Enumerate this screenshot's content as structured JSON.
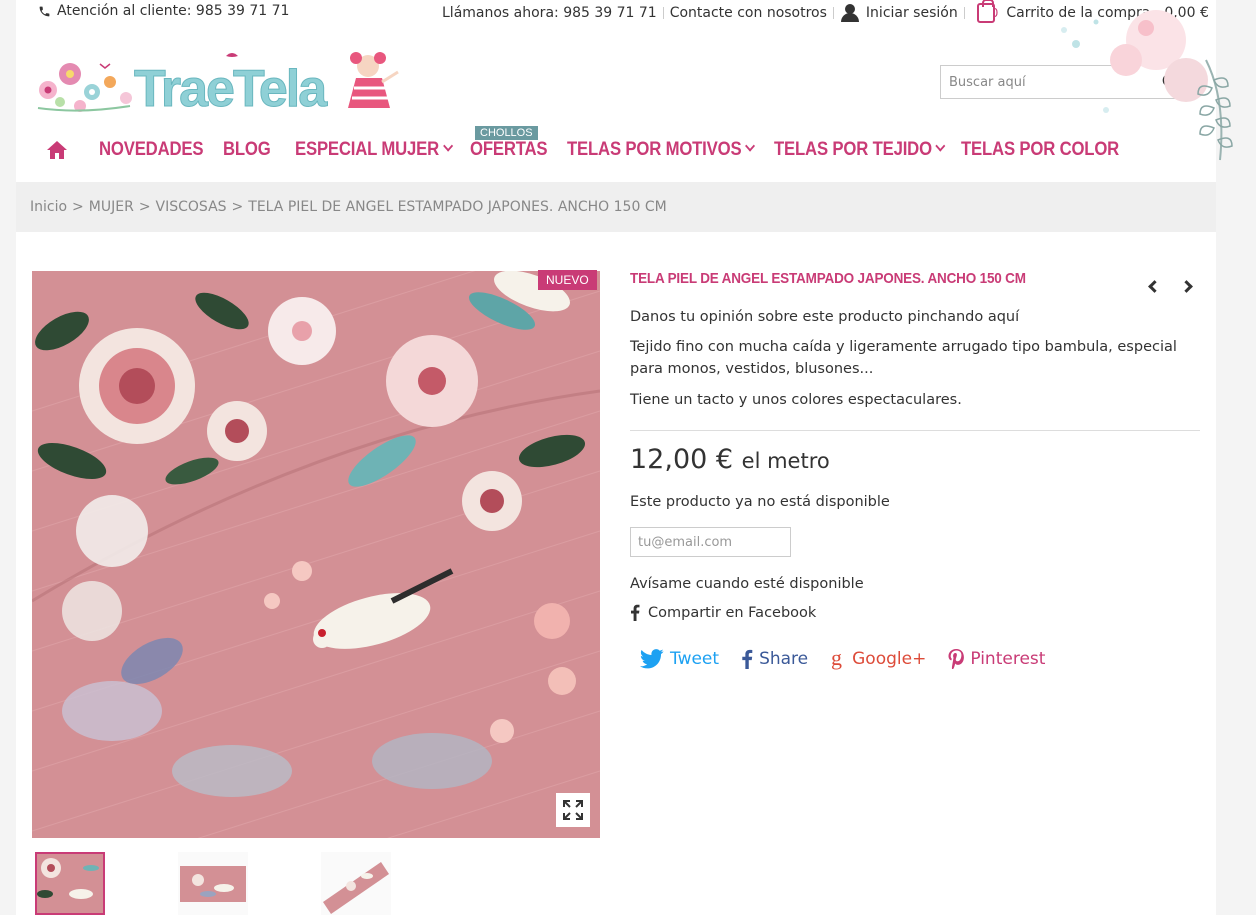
{
  "topbar": {
    "customer_service": "Atención al cliente: 985 39 71 71",
    "call_now": "Llámanos ahora: 985 39 71 71",
    "contact": "Contacte con nosotros",
    "login": "Iniciar sesión",
    "cart_count": "0",
    "cart_label": "Carrito de la compra - 0,00 €"
  },
  "header": {
    "logo_text": "TraeTela",
    "search_placeholder": "Buscar aquí"
  },
  "nav": {
    "items": [
      {
        "label": "NOVEDADES"
      },
      {
        "label": "BLOG"
      },
      {
        "label": "ESPECIAL MUJER"
      },
      {
        "label": "OFERTAS"
      },
      {
        "label": "TELAS POR MOTIVOS"
      },
      {
        "label": "TELAS POR TEJIDO"
      },
      {
        "label": "TELAS POR COLOR"
      }
    ],
    "badge": "CHOLLOS"
  },
  "breadcrumb": [
    "Inicio",
    "MUJER",
    "VISCOSAS",
    "TELA PIEL DE ANGEL ESTAMPADO JAPONES. ANCHO 150 CM"
  ],
  "product": {
    "badge": "NUEVO",
    "title": "TELA PIEL DE ANGEL ESTAMPADO JAPONES. ANCHO 150 CM",
    "review_link": "Danos tu opinión sobre este producto pinchando aquí",
    "description_1": "Tejido fino con mucha caída y ligeramente arrugado tipo bambula, especial para monos, vestidos, blusones...",
    "description_2": "Tiene un tacto y unos colores espectaculares.",
    "price": "12,00 €",
    "price_unit": "el metro",
    "unavailable": "Este producto ya no está disponible",
    "email_placeholder": "tu@email.com",
    "notify": "Avísame cuando esté disponible",
    "facebook_share": "Compartir en Facebook"
  },
  "social": {
    "tweet": "Tweet",
    "share": "Share",
    "googleplus": "Google+",
    "pinterest": "Pinterest"
  },
  "colors": {
    "accent": "#c93b76",
    "logo": "#7ec8cf",
    "fabric": "#d9959b"
  }
}
